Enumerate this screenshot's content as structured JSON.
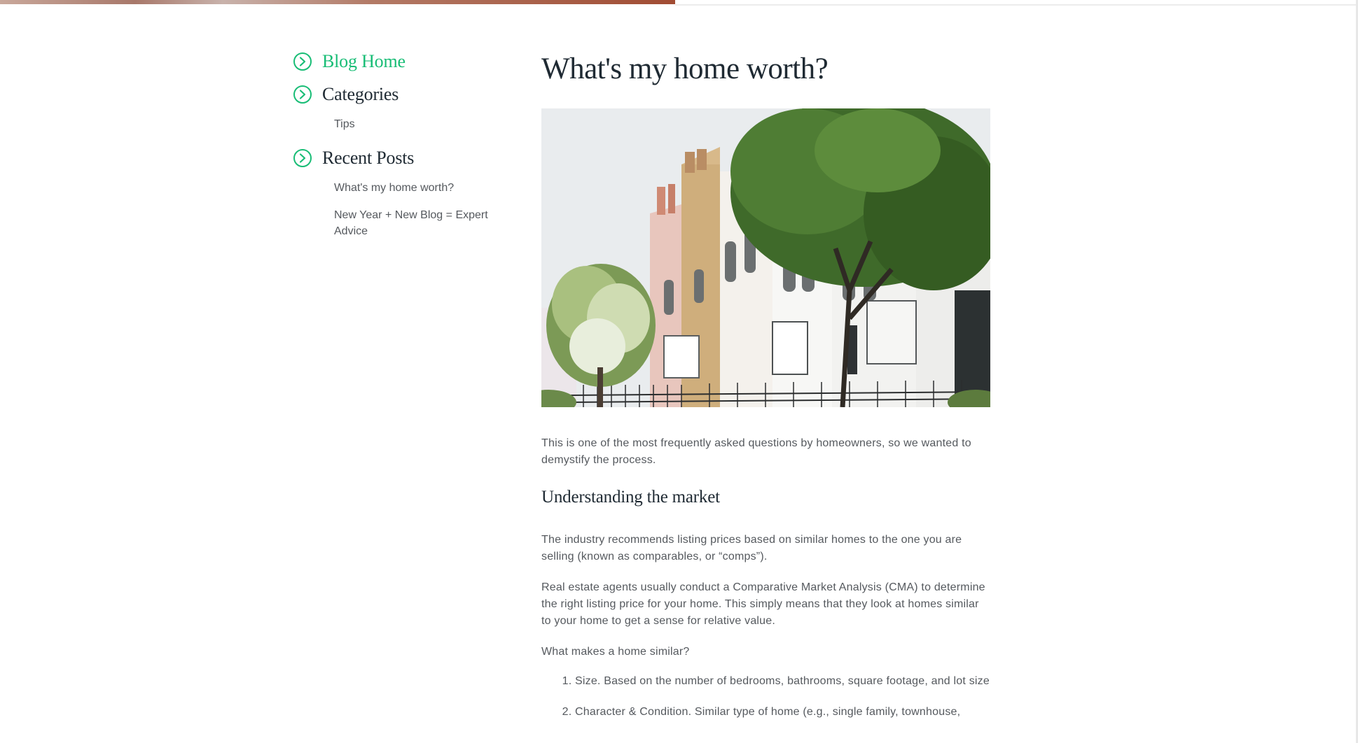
{
  "sidebar": {
    "blog_home": "Blog Home",
    "categories": "Categories",
    "category_items": [
      "Tips"
    ],
    "recent_posts": "Recent Posts",
    "recent_items": [
      "What's my home worth?",
      "New Year + New Blog = Expert Advice"
    ]
  },
  "article": {
    "title": "What's my home worth?",
    "intro": "This is one of the most frequently asked questions by homeowners, so we wanted to demystify the process.",
    "section_heading": "Understanding the market",
    "p1": "The industry recommends listing prices based on similar homes to the one you are selling (known as comparables, or “comps”).",
    "p2": "Real estate agents usually conduct a Comparative Market Analysis (CMA) to determine the right listing price for your home. This simply means that they look at homes similar to your home to get a sense for relative value.",
    "p3": "What makes a home similar?",
    "list": [
      "Size. Based on the number of bedrooms, bathrooms, square footage, and lot size",
      "Character & Condition. Similar type of home (e.g., single family, townhouse,"
    ]
  },
  "colors": {
    "accent": "#19bd76",
    "heading": "#1f2a33",
    "body": "#55595e"
  },
  "icons": {
    "nav_arrow": "circle-chevron-right-icon"
  }
}
